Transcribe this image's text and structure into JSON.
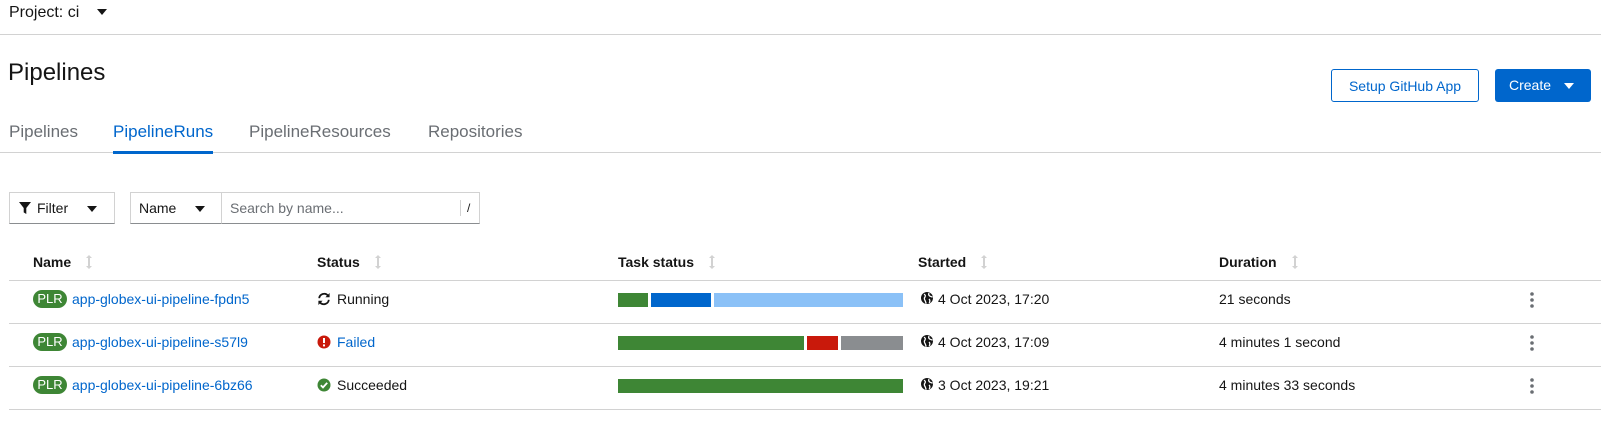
{
  "project": {
    "label": "Project: ci"
  },
  "page": {
    "title": "Pipelines"
  },
  "actions": {
    "setup_label": "Setup GitHub App",
    "create_label": "Create"
  },
  "tabs": [
    {
      "label": "Pipelines",
      "active": false
    },
    {
      "label": "PipelineRuns",
      "active": true
    },
    {
      "label": "PipelineResources",
      "active": false
    },
    {
      "label": "Repositories",
      "active": false
    }
  ],
  "toolbar": {
    "filter_label": "Filter",
    "name_select": "Name",
    "search_placeholder": "Search by name...",
    "search_shortcut": "/"
  },
  "table": {
    "columns": [
      "Name",
      "Status",
      "Task status",
      "Started",
      "Duration"
    ],
    "rows": [
      {
        "badge": "PLR",
        "name": "app-globex-ui-pipeline-fpdn5",
        "status": "Running",
        "status_type": "running",
        "task_segments": [
          {
            "state": "succeeded",
            "fraction": 0.107,
            "color": "#3e8635"
          },
          {
            "state": "running",
            "fraction": 0.214,
            "color": "#0066cc"
          },
          {
            "state": "pending",
            "fraction": 0.679,
            "color": "#8bc1f7"
          }
        ],
        "started": "4 Oct 2023, 17:20",
        "duration": "21 seconds"
      },
      {
        "badge": "PLR",
        "name": "app-globex-ui-pipeline-s57l9",
        "status": "Failed",
        "status_type": "failed",
        "task_segments": [
          {
            "state": "succeeded",
            "fraction": 0.667,
            "color": "#3e8635"
          },
          {
            "state": "failed",
            "fraction": 0.111,
            "color": "#c9190b"
          },
          {
            "state": "cancelled",
            "fraction": 0.222,
            "color": "#8a8d90"
          }
        ],
        "started": "4 Oct 2023, 17:09",
        "duration": "4 minutes 1 second"
      },
      {
        "badge": "PLR",
        "name": "app-globex-ui-pipeline-6bz66",
        "status": "Succeeded",
        "status_type": "succeeded",
        "task_segments": [
          {
            "state": "succeeded",
            "fraction": 1.0,
            "color": "#3e8635"
          }
        ],
        "started": "3 Oct 2023, 19:21",
        "duration": "4 minutes 33 seconds"
      }
    ]
  }
}
